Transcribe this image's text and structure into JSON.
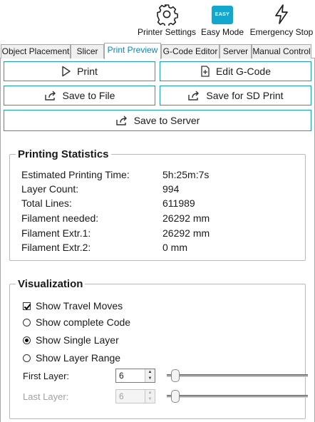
{
  "toolbar": {
    "printer_settings": "Printer Settings",
    "easy_mode": "Easy Mode",
    "easy_badge": "EASY",
    "emergency_stop": "Emergency Stop"
  },
  "tabs": [
    {
      "label": "Object Placement"
    },
    {
      "label": "Slicer"
    },
    {
      "label": "Print Preview",
      "active": true
    },
    {
      "label": "G-Code Editor"
    },
    {
      "label": "Server"
    },
    {
      "label": "Manual Control"
    }
  ],
  "buttons": {
    "print": "Print",
    "edit_gcode": "Edit G-Code",
    "save_to_file": "Save to File",
    "save_sd": "Save for SD Print",
    "save_server": "Save to Server"
  },
  "stats": {
    "title": "Printing Statistics",
    "rows": [
      {
        "label": "Estimated Printing Time:",
        "value": "5h:25m:7s"
      },
      {
        "label": "Layer Count:",
        "value": "994"
      },
      {
        "label": "Total Lines:",
        "value": "611989"
      },
      {
        "label": "Filament needed:",
        "value": "26292 mm"
      },
      {
        "label": "Filament Extr.1:",
        "value": "26292 mm"
      },
      {
        "label": "Filament Extr.2:",
        "value": "0 mm"
      }
    ]
  },
  "visualization": {
    "title": "Visualization",
    "show_travel": "Show Travel Moves",
    "show_travel_checked": true,
    "show_complete": "Show complete Code",
    "show_single": "Show Single Layer",
    "show_range": "Show Layer Range",
    "selected_mode": "Show Single Layer",
    "first_layer_label": "First Layer:",
    "first_layer_value": "6",
    "last_layer_label": "Last Layer:",
    "last_layer_value": "6"
  },
  "colors": {
    "accent": "#14a0c8",
    "active_tab_text": "#0a86c4",
    "easy_badge": "#10a8d0"
  }
}
